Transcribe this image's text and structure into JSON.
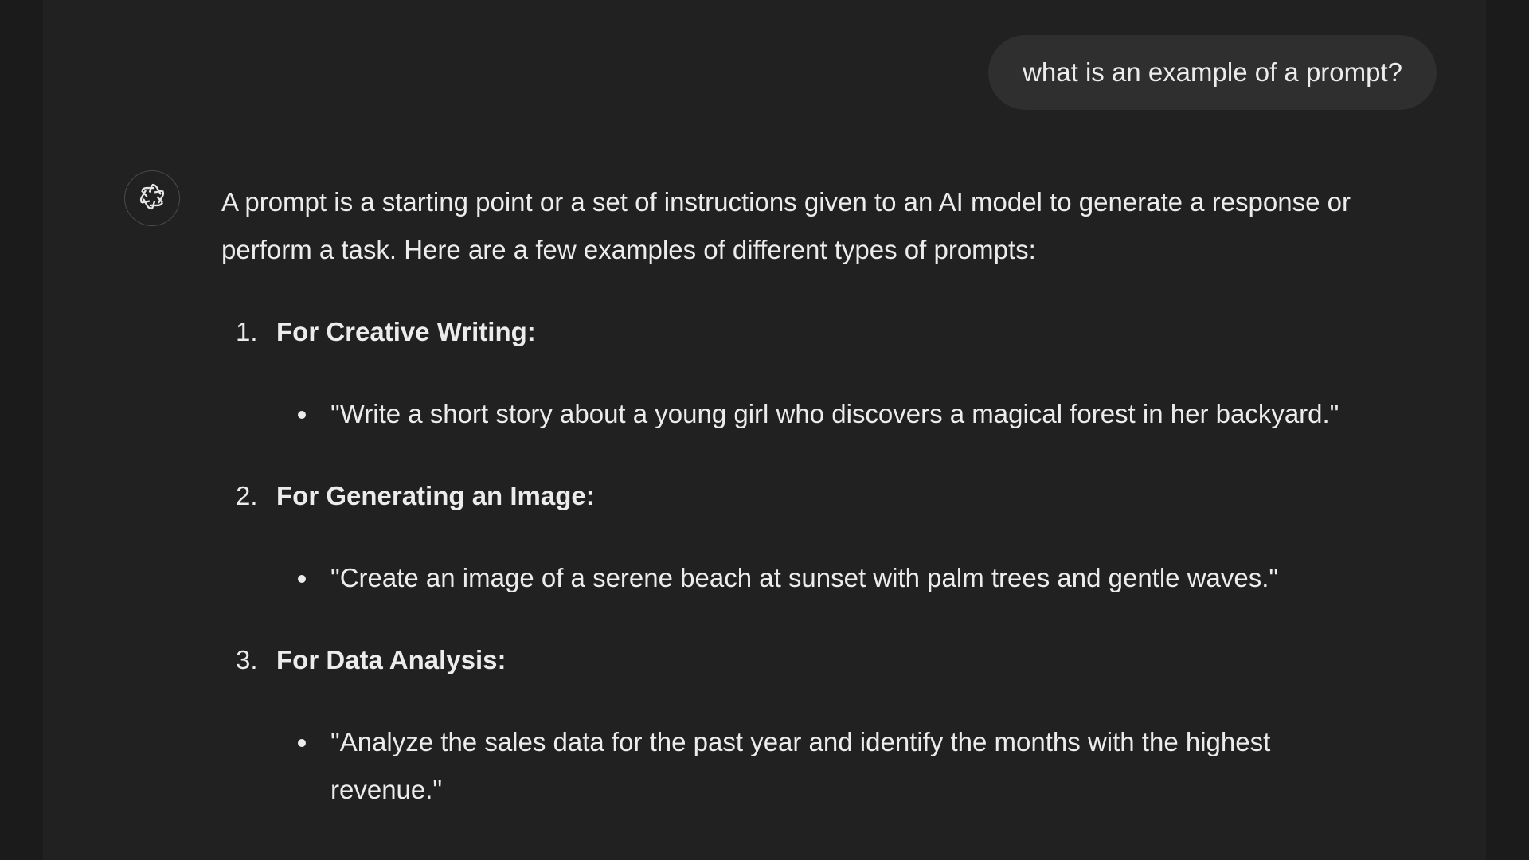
{
  "user_message": {
    "text": "what is an example of a prompt?"
  },
  "assistant": {
    "avatar_icon": "openai-logo-icon",
    "intro": "A prompt is a starting point or a set of instructions given to an AI model to generate a response or perform a task. Here are a few examples of different types of prompts:",
    "items": [
      {
        "number": "1.",
        "heading": "For Creative Writing:",
        "bullet": "\"Write a short story about a young girl who discovers a magical forest in her backyard.\""
      },
      {
        "number": "2.",
        "heading": "For Generating an Image:",
        "bullet": "\"Create an image of a serene beach at sunset with palm trees and gentle waves.\""
      },
      {
        "number": "3.",
        "heading": "For Data Analysis:",
        "bullet": "\"Analyze the sales data for the past year and identify the months with the highest revenue.\""
      }
    ]
  },
  "colors": {
    "background": "#212121",
    "bubble": "#2f2f2f",
    "text": "#ececec",
    "gutter": "#1b1b1b"
  }
}
